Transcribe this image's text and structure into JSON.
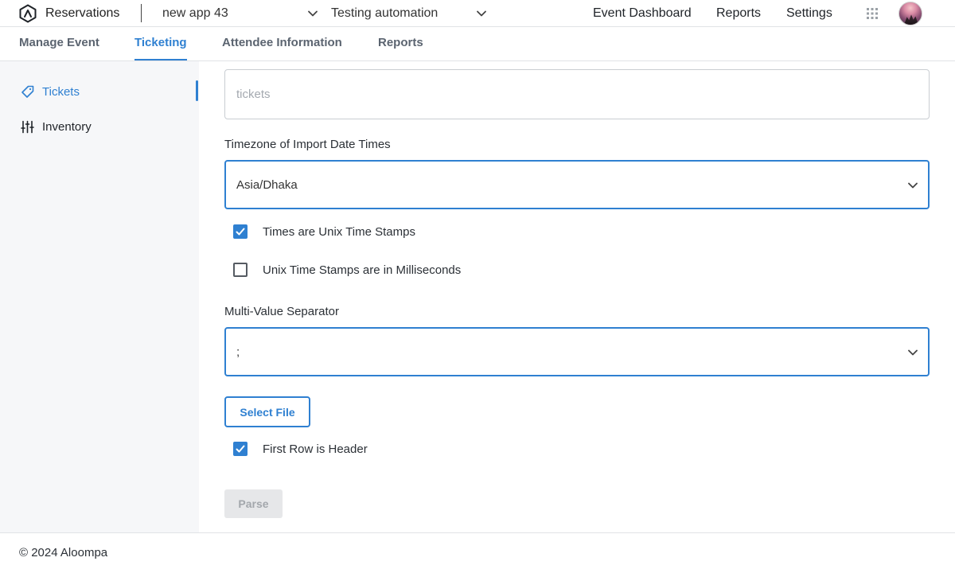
{
  "header": {
    "app_name": "Reservations",
    "app_selector": "new app 43",
    "env_selector": "Testing automation",
    "nav": [
      "Event Dashboard",
      "Reports",
      "Settings"
    ]
  },
  "tabs": [
    {
      "label": "Manage Event",
      "active": false
    },
    {
      "label": "Ticketing",
      "active": true
    },
    {
      "label": "Attendee Information",
      "active": false
    },
    {
      "label": "Reports",
      "active": false
    }
  ],
  "sidebar": {
    "items": [
      {
        "label": "Tickets",
        "icon": "ticket-icon",
        "active": true
      },
      {
        "label": "Inventory",
        "icon": "sliders-icon",
        "active": false
      }
    ]
  },
  "form": {
    "table_field": {
      "value": "",
      "placeholder": "tickets"
    },
    "timezone_label": "Timezone of Import Date Times",
    "timezone_value": "Asia/Dhaka",
    "unix_timestamps": {
      "label": "Times are Unix Time Stamps",
      "checked": true
    },
    "milliseconds": {
      "label": "Unix Time Stamps are in Milliseconds",
      "checked": false
    },
    "separator_label": "Multi-Value Separator",
    "separator_value": ";",
    "select_file_label": "Select File",
    "first_row_header": {
      "label": "First Row is Header",
      "checked": true
    },
    "parse_label": "Parse"
  },
  "footer": {
    "text": "© 2024 Aloompa"
  },
  "colors": {
    "accent": "#2f80d1",
    "sidebar_bg": "#f6f7f9",
    "disabled_bg": "#e6e7e9"
  }
}
